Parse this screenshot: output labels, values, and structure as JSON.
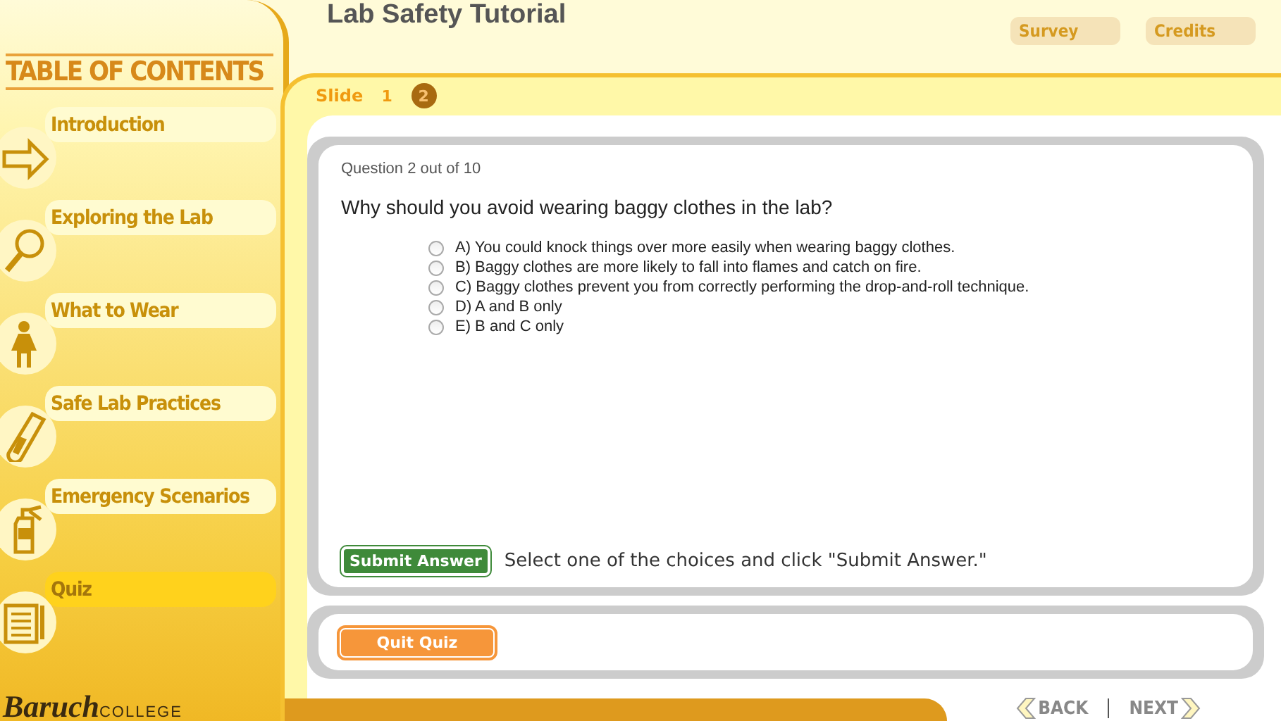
{
  "header": {
    "title": "Lab Safety Tutorial",
    "tabs": [
      {
        "label": "Survey"
      },
      {
        "label": "Credits"
      }
    ]
  },
  "sidebar": {
    "heading": "TABLE OF CONTENTS",
    "items": [
      {
        "label": "Introduction",
        "selected": false
      },
      {
        "label": "Exploring the Lab",
        "selected": false
      },
      {
        "label": "What to Wear",
        "selected": false
      },
      {
        "label": "Safe Lab Practices",
        "selected": false
      },
      {
        "label": "Emergency Scenarios",
        "selected": false
      },
      {
        "label": "Quiz",
        "selected": true
      }
    ],
    "logo": {
      "name": "Baruch",
      "suffix": "COLLEGE"
    }
  },
  "slides": {
    "label": "Slide",
    "items": [
      {
        "label": "1",
        "selected": false
      },
      {
        "label": "2",
        "selected": true
      }
    ]
  },
  "question": {
    "counter": "Question 2 out of 10",
    "text": "Why should you avoid wearing baggy clothes in the lab?",
    "options": [
      {
        "label": "A) You could knock things over more easily when wearing baggy clothes.",
        "selected": false
      },
      {
        "label": "B) Baggy clothes are more likely to fall into flames and catch on fire.",
        "selected": false
      },
      {
        "label": "C) Baggy clothes prevent you from correctly performing the drop-and-roll technique.",
        "selected": false
      },
      {
        "label": "D) A and B only",
        "selected": false
      },
      {
        "label": "E) B and C only",
        "selected": false
      }
    ],
    "submit": "Submit Answer",
    "hint": "Select one of the choices and click \"Submit Answer.\""
  },
  "quit": "Quit Quiz",
  "nav": {
    "back": "BACK",
    "next": "NEXT"
  }
}
